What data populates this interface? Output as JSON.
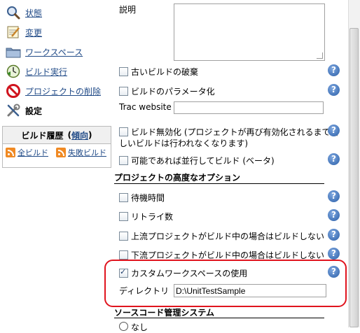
{
  "sidebar": {
    "items": [
      {
        "label": "状態",
        "icon": "search-icon"
      },
      {
        "label": "変更",
        "icon": "notepad-icon"
      },
      {
        "label": "ワークスペース",
        "icon": "folder-icon"
      },
      {
        "label": "ビルド実行",
        "icon": "build-clock-icon"
      },
      {
        "label": "プロジェクトの削除",
        "icon": "delete-icon"
      },
      {
        "label": "設定",
        "icon": "tools-icon"
      }
    ],
    "history": {
      "title": "ビルド履歴",
      "trend_open": "(",
      "trend": "傾向",
      "trend_close": ")",
      "all_builds": "全ビルド",
      "failed_builds": "失敗ビルド"
    }
  },
  "main": {
    "description_label": "説明",
    "options": [
      {
        "label": "古いビルドの破棄",
        "checked": false
      },
      {
        "label": "ビルドのパラメータ化",
        "checked": false
      }
    ],
    "trac_label": "Trac website",
    "trac_value": "",
    "disable_line1": "ビルド無効化 (プロジェクトが再び有効化されるまで新",
    "disable_line2": "しいビルドは行われなくなります)",
    "concurrent_label": "可能であれば並行してビルド (ベータ)",
    "advanced_title": "プロジェクトの高度なオプション",
    "advanced_options": [
      {
        "label": "待機時間",
        "checked": false
      },
      {
        "label": "リトライ数",
        "checked": false
      },
      {
        "label": "上流プロジェクトがビルド中の場合はビルドしない",
        "checked": false
      },
      {
        "label": "下流プロジェクトがビルド中の場合はビルドしない",
        "checked": false
      }
    ],
    "custom_workspace_label": "カスタムワークスペースの使用",
    "custom_workspace_checked": true,
    "directory_label": "ディレクトリ",
    "directory_value": "D:\\UnitTestSample",
    "scm_title": "ソースコード管理システム",
    "scm_first_option": "なし",
    "help_glyph": "?"
  },
  "colors": {
    "link": "#204a87",
    "highlight": "#e0141e",
    "help": "#2b5fa8",
    "rss": "#f08a24"
  }
}
